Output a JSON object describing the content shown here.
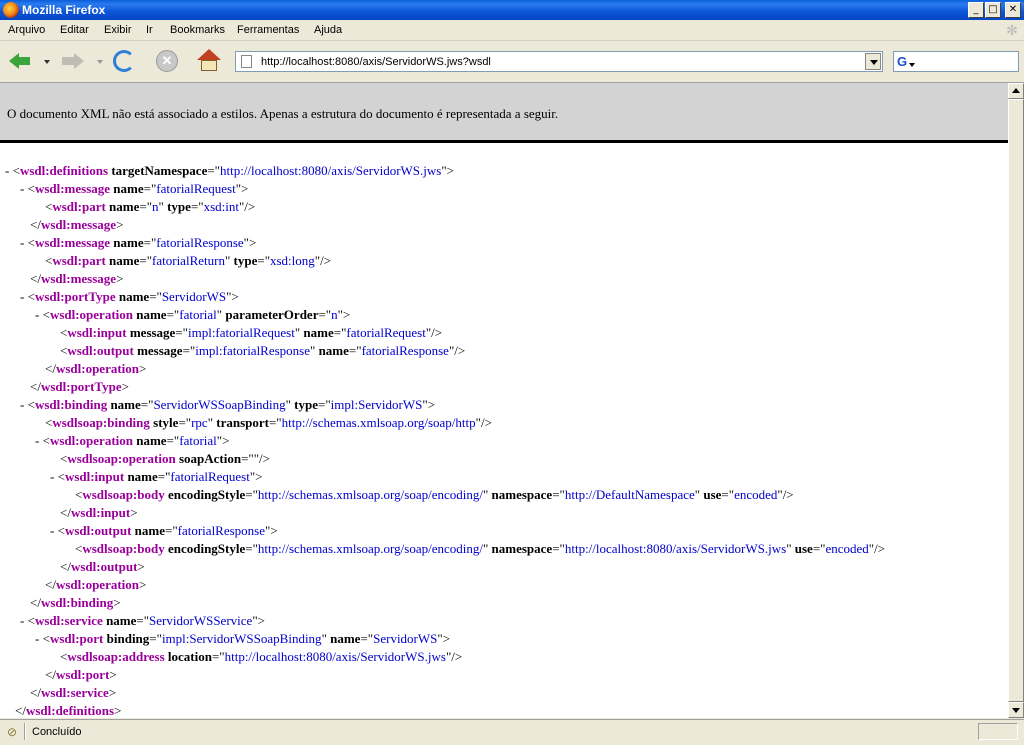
{
  "window": {
    "title": "Mozilla Firefox",
    "min_glyph": "_",
    "max_glyph": "□",
    "close_glyph": "✕"
  },
  "menu": [
    "Arquivo",
    "Editar",
    "Exibir",
    "Ir",
    "Bookmarks",
    "Ferramentas",
    "Ajuda"
  ],
  "toolbar": {
    "url": "http://localhost:8080/axis/ServidorWS.jws?wsdl",
    "search_engine_glyph": "G",
    "stop_glyph": "✕"
  },
  "notice": "O documento XML não está associado a estilos. Apenas a estrutura do documento é representada a seguir.",
  "xml_lines": [
    {
      "marker": "-",
      "open": "<",
      "tag": "wsdl:definitions",
      "attrs": [
        {
          "n": "targetNamespace",
          "v": "http://localhost:8080/axis/ServidorWS.jws"
        }
      ],
      "close": ">"
    },
    {
      "marker": "-",
      "open": "<",
      "tag": "wsdl:message",
      "attrs": [
        {
          "n": "name",
          "v": "fatorialRequest"
        }
      ],
      "close": ">"
    },
    {
      "marker": "",
      "open": "<",
      "tag": "wsdl:part",
      "attrs": [
        {
          "n": "name",
          "v": "n"
        },
        {
          "n": "type",
          "v": "xsd:int"
        }
      ],
      "close": "/>"
    },
    {
      "marker": "",
      "open": "</",
      "tag": "wsdl:message",
      "attrs": [],
      "close": ">"
    },
    {
      "marker": "-",
      "open": "<",
      "tag": "wsdl:message",
      "attrs": [
        {
          "n": "name",
          "v": "fatorialResponse"
        }
      ],
      "close": ">"
    },
    {
      "marker": "",
      "open": "<",
      "tag": "wsdl:part",
      "attrs": [
        {
          "n": "name",
          "v": "fatorialReturn"
        },
        {
          "n": "type",
          "v": "xsd:long"
        }
      ],
      "close": "/>"
    },
    {
      "marker": "",
      "open": "</",
      "tag": "wsdl:message",
      "attrs": [],
      "close": ">"
    },
    {
      "marker": "-",
      "open": "<",
      "tag": "wsdl:portType",
      "attrs": [
        {
          "n": "name",
          "v": "ServidorWS"
        }
      ],
      "close": ">"
    },
    {
      "marker": "-",
      "open": "<",
      "tag": "wsdl:operation",
      "attrs": [
        {
          "n": "name",
          "v": "fatorial"
        },
        {
          "n": "parameterOrder",
          "v": "n"
        }
      ],
      "close": ">"
    },
    {
      "marker": "",
      "open": "<",
      "tag": "wsdl:input",
      "attrs": [
        {
          "n": "message",
          "v": "impl:fatorialRequest"
        },
        {
          "n": "name",
          "v": "fatorialRequest"
        }
      ],
      "close": "/>"
    },
    {
      "marker": "",
      "open": "<",
      "tag": "wsdl:output",
      "attrs": [
        {
          "n": "message",
          "v": "impl:fatorialResponse"
        },
        {
          "n": "name",
          "v": "fatorialResponse"
        }
      ],
      "close": "/>"
    },
    {
      "marker": "",
      "open": "</",
      "tag": "wsdl:operation",
      "attrs": [],
      "close": ">"
    },
    {
      "marker": "",
      "open": "</",
      "tag": "wsdl:portType",
      "attrs": [],
      "close": ">"
    },
    {
      "marker": "-",
      "open": "<",
      "tag": "wsdl:binding",
      "attrs": [
        {
          "n": "name",
          "v": "ServidorWSSoapBinding"
        },
        {
          "n": "type",
          "v": "impl:ServidorWS"
        }
      ],
      "close": ">"
    },
    {
      "marker": "",
      "open": "<",
      "tag": "wsdlsoap:binding",
      "attrs": [
        {
          "n": "style",
          "v": "rpc"
        },
        {
          "n": "transport",
          "v": "http://schemas.xmlsoap.org/soap/http"
        }
      ],
      "close": "/>"
    },
    {
      "marker": "-",
      "open": "<",
      "tag": "wsdl:operation",
      "attrs": [
        {
          "n": "name",
          "v": "fatorial"
        }
      ],
      "close": ">"
    },
    {
      "marker": "",
      "open": "<",
      "tag": "wsdlsoap:operation",
      "attrs": [
        {
          "n": "soapAction",
          "v": ""
        }
      ],
      "close": "/>"
    },
    {
      "marker": "-",
      "open": "<",
      "tag": "wsdl:input",
      "attrs": [
        {
          "n": "name",
          "v": "fatorialRequest"
        }
      ],
      "close": ">"
    },
    {
      "marker": "",
      "open": "<",
      "tag": "wsdlsoap:body",
      "attrs": [
        {
          "n": "encodingStyle",
          "v": "http://schemas.xmlsoap.org/soap/encoding/"
        },
        {
          "n": "namespace",
          "v": "http://DefaultNamespace"
        },
        {
          "n": "use",
          "v": "encoded"
        }
      ],
      "close": "/>"
    },
    {
      "marker": "",
      "open": "</",
      "tag": "wsdl:input",
      "attrs": [],
      "close": ">"
    },
    {
      "marker": "-",
      "open": "<",
      "tag": "wsdl:output",
      "attrs": [
        {
          "n": "name",
          "v": "fatorialResponse"
        }
      ],
      "close": ">"
    },
    {
      "marker": "",
      "open": "<",
      "tag": "wsdlsoap:body",
      "attrs": [
        {
          "n": "encodingStyle",
          "v": "http://schemas.xmlsoap.org/soap/encoding/"
        },
        {
          "n": "namespace",
          "v": "http://localhost:8080/axis/ServidorWS.jws"
        },
        {
          "n": "use",
          "v": "encoded"
        }
      ],
      "close": "/>"
    },
    {
      "marker": "",
      "open": "</",
      "tag": "wsdl:output",
      "attrs": [],
      "close": ">"
    },
    {
      "marker": "",
      "open": "</",
      "tag": "wsdl:operation",
      "attrs": [],
      "close": ">"
    },
    {
      "marker": "",
      "open": "</",
      "tag": "wsdl:binding",
      "attrs": [],
      "close": ">"
    },
    {
      "marker": "-",
      "open": "<",
      "tag": "wsdl:service",
      "attrs": [
        {
          "n": "name",
          "v": "ServidorWSService"
        }
      ],
      "close": ">"
    },
    {
      "marker": "-",
      "open": "<",
      "tag": "wsdl:port",
      "attrs": [
        {
          "n": "binding",
          "v": "impl:ServidorWSSoapBinding"
        },
        {
          "n": "name",
          "v": "ServidorWS"
        }
      ],
      "close": ">"
    },
    {
      "marker": "",
      "open": "<",
      "tag": "wsdlsoap:address",
      "attrs": [
        {
          "n": "location",
          "v": "http://localhost:8080/axis/ServidorWS.jws"
        }
      ],
      "close": "/>"
    },
    {
      "marker": "",
      "open": "</",
      "tag": "wsdl:port",
      "attrs": [],
      "close": ">"
    },
    {
      "marker": "",
      "open": "</",
      "tag": "wsdl:service",
      "attrs": [],
      "close": ">"
    },
    {
      "marker": "",
      "open": "</",
      "tag": "wsdl:definitions",
      "attrs": [],
      "close": ">"
    }
  ],
  "status": {
    "text": "Concluído"
  }
}
